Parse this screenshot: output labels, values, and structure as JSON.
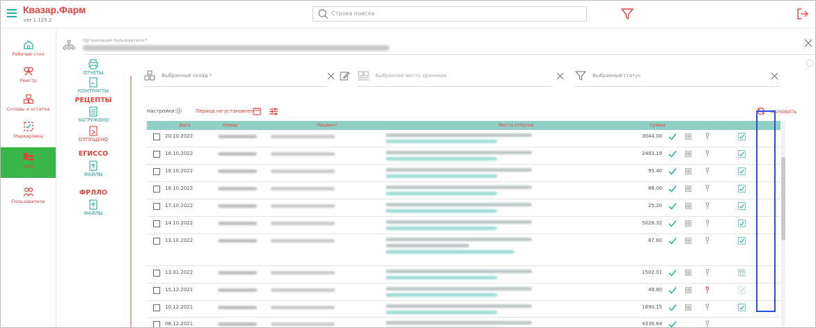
{
  "app": {
    "title": "Квазар.Фарм",
    "version": "ver 1.125.2"
  },
  "search": {
    "placeholder": "Строка поиска"
  },
  "colors": {
    "accent": "#e6423c",
    "teal": "#27ae9a",
    "active_green": "#39b54a",
    "highlight": "#2a4de0"
  },
  "left_nav": [
    {
      "label": "Рабочий стол",
      "icon": "home-icon"
    },
    {
      "label": "Реестр",
      "icon": "registry-icon"
    },
    {
      "label": "Склады и остатки",
      "icon": "warehouse-icon"
    },
    {
      "label": "Маркировка",
      "icon": "marking-icon"
    },
    {
      "label": "ЛЛО",
      "icon": "llo-icon",
      "active": true
    },
    {
      "label": "Пользователи",
      "icon": "users-icon"
    }
  ],
  "middle_nav": {
    "reports": "ОТЧЕТЫ",
    "contracts": "КОНТРАКТЫ",
    "recipes_head": "РЕЦЕПТЫ",
    "loaded": "ЗАГРУЖЕНО",
    "released": "ОТПУЩЕНО",
    "egisso_head": "ЕГИССО",
    "egisso_files": "ФАЙЛЫ",
    "frllo_head": "ФРЛЛО",
    "frllo_files": "ФАЙЛЫ"
  },
  "org": {
    "label": "Организация пользователя *"
  },
  "filters": {
    "warehouse": "Выбранный склад *",
    "storage": "Выбранное место хранения",
    "status": "Выбранный статус"
  },
  "toolbar": {
    "settings": "Настройки",
    "period": "Период не установлен",
    "refresh": "ОБНОВИТЬ"
  },
  "table": {
    "headers": {
      "date": "Дата",
      "number": "Номер",
      "patient": "Пациент",
      "place": "Место отпуска",
      "sum": "Сумма"
    },
    "rows": [
      {
        "date": "20.10.2022",
        "sum": "3044.00"
      },
      {
        "date": "18.10.2022",
        "sum": "2483.19"
      },
      {
        "date": "18.10.2022",
        "sum": "95.40"
      },
      {
        "date": "18.10.2022",
        "sum": "88.00"
      },
      {
        "date": "17.10.2022",
        "sum": "25.20"
      },
      {
        "date": "14.10.2022",
        "sum": "5026.32"
      },
      {
        "date": "13.10.2022",
        "sum": "87.60"
      },
      {
        "date": "13.01.2022",
        "sum": "1502.01"
      },
      {
        "date": "15.12.2021",
        "sum": "49.80"
      },
      {
        "date": "10.12.2021",
        "sum": "1890.15"
      },
      {
        "date": "08.12.2021",
        "sum": "4336.64"
      }
    ]
  }
}
